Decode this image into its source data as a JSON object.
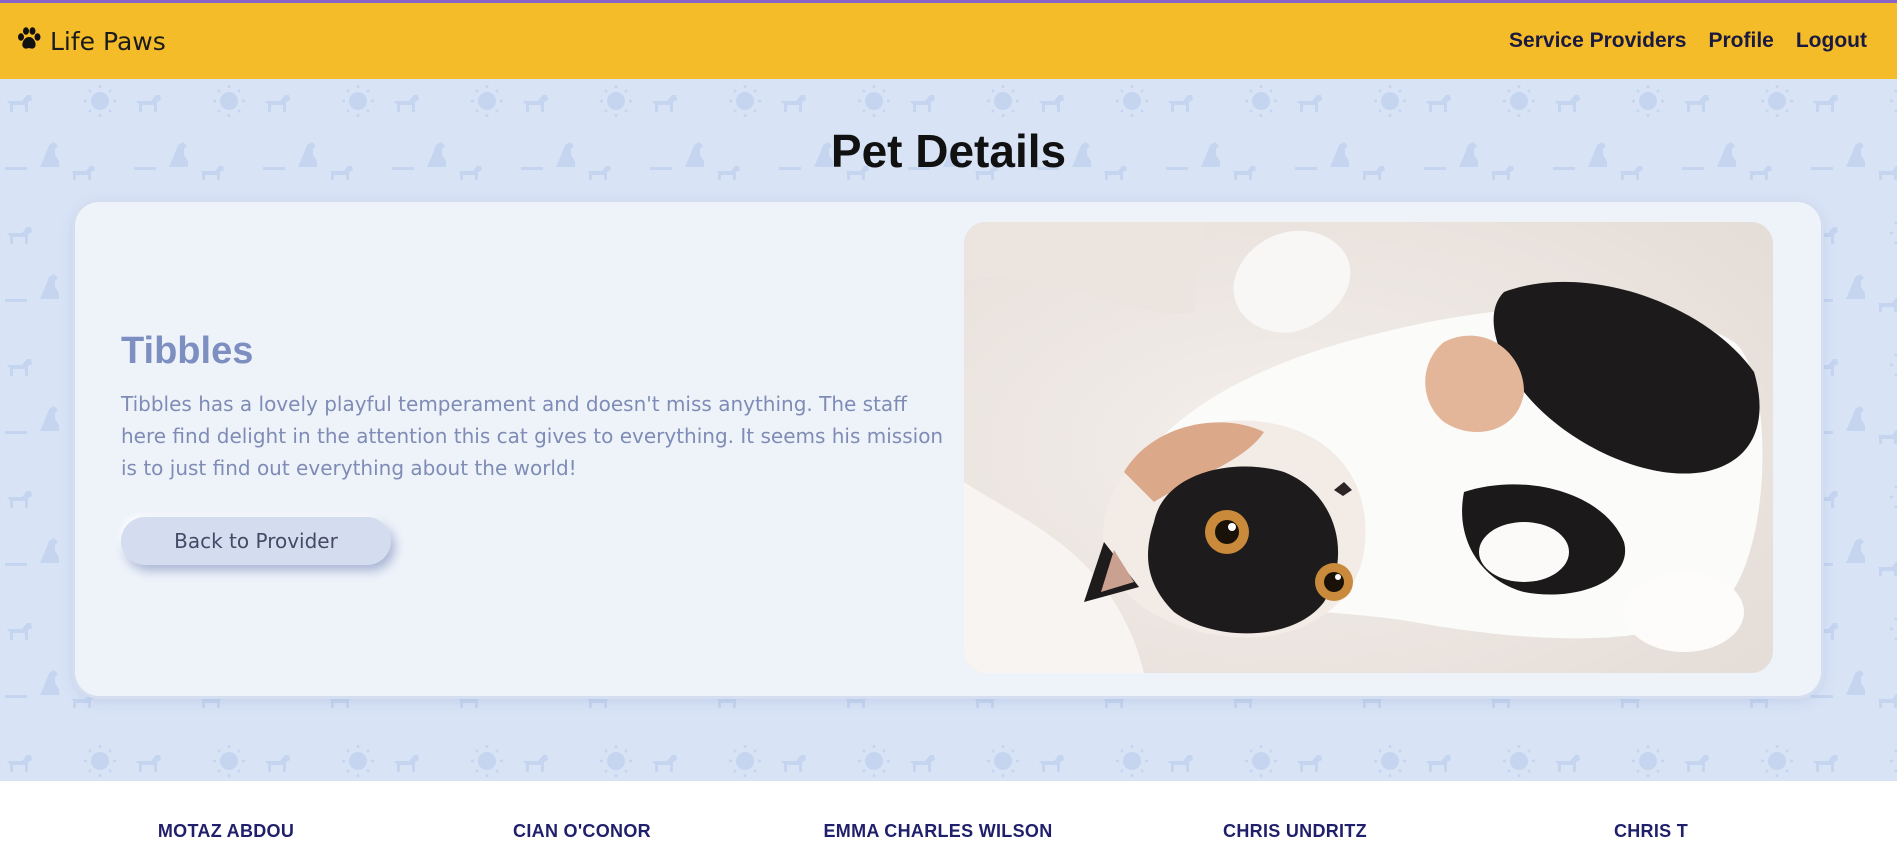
{
  "app": {
    "brand_icon": "paw-icon",
    "brand": "Life Paws"
  },
  "nav": {
    "items": [
      {
        "label": "Service Providers"
      },
      {
        "label": "Profile"
      },
      {
        "label": "Logout"
      }
    ]
  },
  "page": {
    "title": "Pet Details"
  },
  "pet": {
    "name": "Tibbles",
    "description": "Tibbles has a lovely playful temperament and doesn't miss anything. The staff here find delight in the attention this cat gives to everything. It seems his mission is to just find out everything about the world!",
    "back_button": "Back to Provider"
  },
  "footer": {
    "names": [
      "MOTAZ ABDOU",
      "CIAN O'CONOR",
      "EMMA CHARLES WILSON",
      "CHRIS UNDRITZ",
      "CHRIS T"
    ]
  },
  "colors": {
    "navbar": "#f5bc2a",
    "background": "#d8e3f6",
    "card": "#eef3fa",
    "accent_text": "#7d8fc0",
    "footer_text": "#1f1f6b"
  }
}
